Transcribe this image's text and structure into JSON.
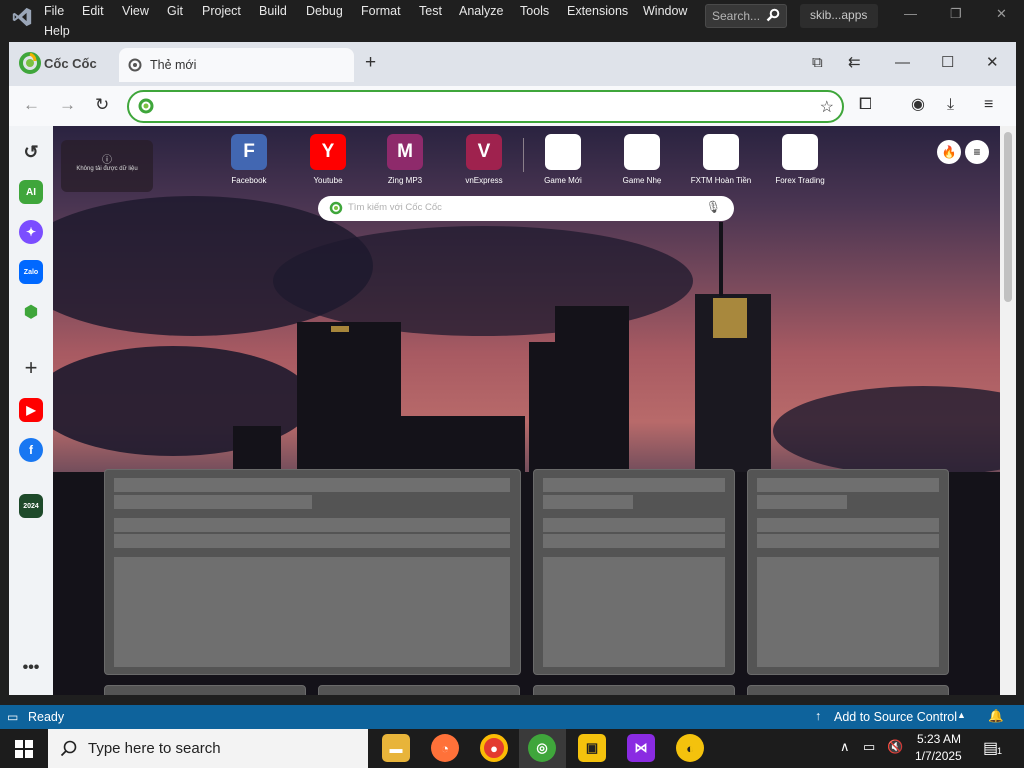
{
  "vs": {
    "menu": [
      "File",
      "Edit",
      "View",
      "Git",
      "Project",
      "Build",
      "Debug",
      "Format",
      "Test",
      "Analyze",
      "Tools",
      "Extensions",
      "Window",
      "Help"
    ],
    "search_placeholder": "Search...",
    "solution": "skib...apps",
    "controls": [
      "—",
      "❐",
      "✕"
    ]
  },
  "browser": {
    "brand": "Cốc Cốc",
    "tab_title": "Thẻ mới",
    "new_tab": "+",
    "title_controls": [
      "—",
      "☐",
      "✕"
    ],
    "address_value": "",
    "ntp": {
      "weather_text": "Không tải được dữ liệu",
      "speed_dials": [
        {
          "letter": "F",
          "label": "Facebook",
          "color": "#4267b2"
        },
        {
          "letter": "Y",
          "label": "Youtube",
          "color": "#ff0000"
        },
        {
          "letter": "M",
          "label": "Zing MP3",
          "color": "#8e2a6b"
        },
        {
          "letter": "V",
          "label": "vnExpress",
          "color": "#9f224e"
        },
        {
          "letter": "",
          "label": "Game Mới",
          "color": "#ffffff"
        },
        {
          "letter": "",
          "label": "Game Nhẹ",
          "color": "#ffffff"
        },
        {
          "letter": "",
          "label": "FXTM Hoàn Tiền",
          "color": "#ffffff"
        },
        {
          "letter": "",
          "label": "Forex Trading",
          "color": "#ffffff"
        }
      ],
      "search_placeholder": "Tìm kiếm với Cốc Cốc"
    },
    "sidebar": [
      "history-icon",
      "ai-icon",
      "messenger-icon",
      "zalo-icon",
      "game-icon",
      "add-icon",
      "youtube-icon",
      "facebook-icon",
      "coccoc-2024-icon",
      "more-icon"
    ]
  },
  "status": {
    "ready": "Ready",
    "source_control": "Add to Source Control",
    "notifications": "1"
  },
  "taskbar": {
    "search_placeholder": "Type here to search",
    "apps": [
      "file-explorer-icon",
      "firefox-icon",
      "chrome-icon",
      "coccoc-icon",
      "app-icon",
      "visual-studio-icon",
      "app2-icon"
    ],
    "time": "5:23 AM",
    "date": "1/7/2025",
    "notification_count": "1"
  },
  "colors": {
    "vs_status": "#0e639c",
    "coccoc_green": "#3fa63b"
  }
}
